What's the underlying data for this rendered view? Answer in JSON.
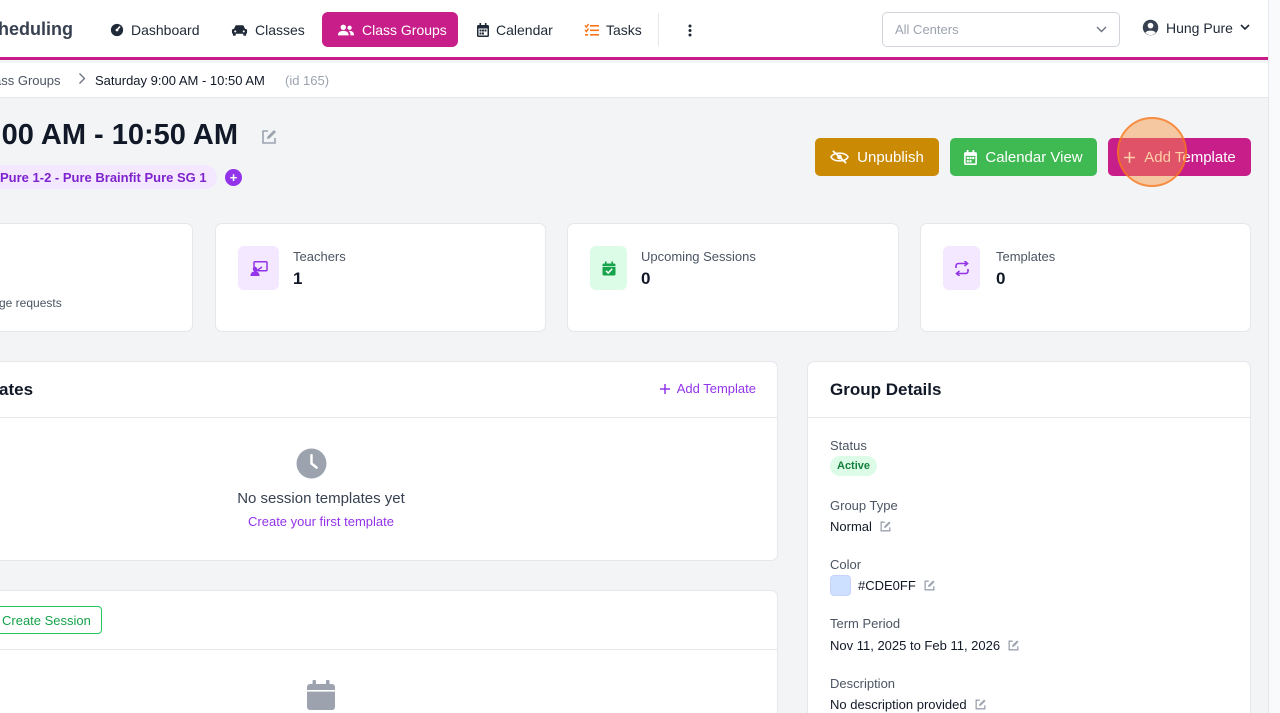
{
  "nav": {
    "brand": "heduling",
    "items": [
      {
        "label": "Dashboard",
        "icon": "dashboard-icon"
      },
      {
        "label": "Classes",
        "icon": "car-icon"
      },
      {
        "label": "Class Groups",
        "icon": "users-icon",
        "active": true
      },
      {
        "label": "Calendar",
        "icon": "calendar-icon"
      },
      {
        "label": "Tasks",
        "icon": "tasks-icon"
      }
    ],
    "center_select": {
      "value": "All Centers"
    },
    "user": {
      "name": "Hung Pure"
    }
  },
  "breadcrumb": {
    "parent": "ass Groups",
    "current": "Saturday 9:00 AM - 10:50 AM",
    "id": "(id 165)"
  },
  "header": {
    "title": ":00 AM - 10:50 AM",
    "tag": "Pure 1-2 - Pure Brainfit Pure SG 1",
    "tag_add": "+"
  },
  "actions": {
    "unpublish": "Unpublish",
    "calendar_view": "Calendar View",
    "add_template": "Add Template"
  },
  "stats": {
    "requests_sub": "ge requests",
    "teachers": {
      "label": "Teachers",
      "value": "1"
    },
    "upcoming": {
      "label": "Upcoming Sessions",
      "value": "0"
    },
    "templates": {
      "label": "Templates",
      "value": "0"
    }
  },
  "templates_panel": {
    "title": "ates",
    "add_link": "Add Template",
    "empty_title": "No session templates yet",
    "empty_link": "Create your first template"
  },
  "sessions_panel": {
    "create_button": "Create Session"
  },
  "group_details": {
    "title": "Group Details",
    "status_label": "Status",
    "status_value": "Active",
    "type_label": "Group Type",
    "type_value": "Normal",
    "color_label": "Color",
    "color_value": "#CDE0FF",
    "term_label": "Term Period",
    "term_value": "Nov 11, 2025 to Feb 11, 2026",
    "description_label": "Description",
    "description_value": "No description provided"
  },
  "colors": {
    "brand_magenta": "#c81e8a",
    "unpublish": "#ca8a04",
    "calendar_green": "#3fb951",
    "purple_accent": "#9333ea",
    "swatch": "#CDE0FF"
  }
}
